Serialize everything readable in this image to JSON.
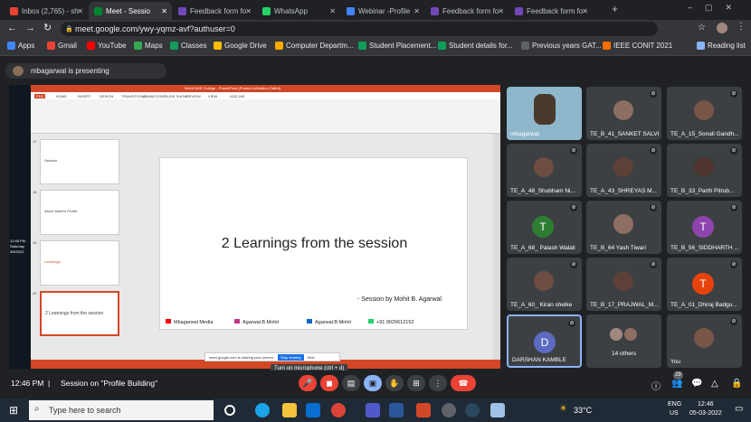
{
  "tabs": [
    {
      "label": "Inbox (2,765) - sh",
      "color": "#ea4335",
      "active": false
    },
    {
      "label": "Meet - Sessio",
      "color": "#00832d",
      "active": true
    },
    {
      "label": "Feedback form fo",
      "color": "#7248b9",
      "active": false
    },
    {
      "label": "WhatsApp",
      "color": "#25d366",
      "active": false
    },
    {
      "label": "Webinar -Profile",
      "color": "#4285f4",
      "active": false
    },
    {
      "label": "Feedback form fo",
      "color": "#7248b9",
      "active": false
    },
    {
      "label": "Feedback form fo",
      "color": "#7248b9",
      "active": false
    }
  ],
  "url": "meet.google.com/ywy-yqmz-avf?authuser=0",
  "bookmarks": [
    "Apps",
    "Gmail",
    "YouTube",
    "Maps",
    "Classes",
    "Google Drive",
    "Computer Departm...",
    "Student Placement...",
    "Student details for...",
    "Previous years GAT...",
    "IEEE CONIT 2021",
    "Reading list"
  ],
  "presenter": "mbagarwal is presenting",
  "slide": {
    "title": "2 Learnings from the session",
    "byline": "- Session by Mohit B. Agarwal",
    "footer": [
      "Mbagarwal Media",
      "Agarwal.B.Mohit",
      "Agarwal.B.Mohit",
      "+91 9029612152"
    ],
    "ppt_title": "Mohit NGE College - PowerPoint (Product Activation Failed)",
    "ribbon_tabs": [
      "FILE",
      "HOME",
      "INSERT",
      "DESIGN",
      "TRANSITIONS",
      "ANIMATIONS",
      "SLIDE SHOW",
      "REVIEW",
      "VIEW",
      "ADD-INS"
    ],
    "thumbs": [
      {
        "num": "17",
        "text": "Session"
      },
      {
        "num": "18",
        "text": "About Mohit's Profile"
      },
      {
        "num": "19",
        "text": "Learnings"
      },
      {
        "num": "20",
        "text": "2 Learnings from the session"
      }
    ],
    "sharing_notice": "meet.google.com is sharing your screen.",
    "stop_sharing": "Stop sharing",
    "hide": "Hide",
    "tooltip": "Turn on microphone (ctrl + d)",
    "win_time": "12:46 PM",
    "win_day": "Saturday",
    "win_date": "3/5/2022"
  },
  "participants": [
    {
      "name": "mbagarwal",
      "type": "video"
    },
    {
      "name": "TE_B_41_SANKET SALVI",
      "type": "photo"
    },
    {
      "name": "TE_A_15_Sonali Gandh...",
      "type": "photo"
    },
    {
      "name": "TE_A_48_Shubham Ni...",
      "type": "photo"
    },
    {
      "name": "TE_A_43_SHREYAS M...",
      "type": "photo"
    },
    {
      "name": "TE_B_33_Parth Pitrub...",
      "type": "photo"
    },
    {
      "name": "TE_A_68_ Palash Walali",
      "type": "letter",
      "letter": "T",
      "color": "#2e7d32"
    },
    {
      "name": "TE_B_64 Yash Tiwari",
      "type": "photo"
    },
    {
      "name": "TE_B_56_SIDDHARTH ...",
      "type": "letter",
      "letter": "T",
      "color": "#8e44ad"
    },
    {
      "name": "TE_A_60_ Kiran shelke",
      "type": "photo"
    },
    {
      "name": "TE_B_17_PRAJWAL_M...",
      "type": "photo"
    },
    {
      "name": "TE_A_01_Dhiraj Badgu...",
      "type": "letter",
      "letter": "T",
      "color": "#e8430c"
    },
    {
      "name": "DARSHAN KAMBLE",
      "type": "letter",
      "letter": "D",
      "color": "#5c6bc0"
    },
    {
      "name": "14 others",
      "type": "others"
    },
    {
      "name": "You",
      "type": "photo"
    }
  ],
  "meeting": {
    "time": "12:46 PM",
    "separator": "|",
    "title": "Session on \"Profile Building\"",
    "people_count": "29"
  },
  "taskbar": {
    "search": "Type here to search",
    "temp": "33°C",
    "lang": "ENG",
    "region": "US",
    "time": "12:46",
    "date": "05-03-2022"
  }
}
